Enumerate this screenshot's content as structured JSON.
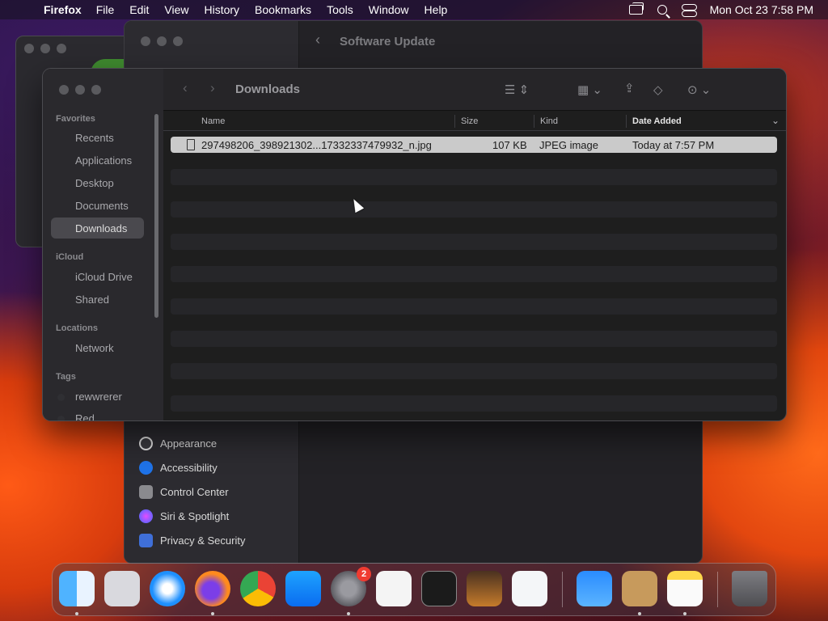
{
  "menubar": {
    "app_name": "Firefox",
    "items": [
      "File",
      "Edit",
      "View",
      "History",
      "Bookmarks",
      "Tools",
      "Window",
      "Help"
    ],
    "clock": "Mon Oct 23  7:58 PM"
  },
  "settings_window": {
    "title": "Software Update",
    "sidebar_items": [
      "Appearance",
      "Accessibility",
      "Control Center",
      "Siri & Spotlight",
      "Privacy & Security"
    ]
  },
  "finder": {
    "title": "Downloads",
    "sidebar": {
      "favorites_header": "Favorites",
      "favorites": [
        "Recents",
        "Applications",
        "Desktop",
        "Documents",
        "Downloads"
      ],
      "icloud_header": "iCloud",
      "icloud": [
        "iCloud Drive",
        "Shared"
      ],
      "locations_header": "Locations",
      "locations": [
        "Network"
      ],
      "tags_header": "Tags",
      "tags": [
        "rewwrerer",
        "Red"
      ]
    },
    "columns": {
      "name": "Name",
      "size": "Size",
      "kind": "Kind",
      "date": "Date Added"
    },
    "files": [
      {
        "name": "297498206_398921302...17332337479932_n.jpg",
        "size": "107 KB",
        "kind": "JPEG image",
        "date": "Today at 7:57 PM"
      }
    ]
  },
  "dock": {
    "apps": [
      "Finder",
      "Launchpad",
      "Safari",
      "Firefox",
      "Chrome",
      "App Store",
      "System Settings",
      "TextEdit",
      "Terminal",
      "GarageBand",
      "Visual Studio Code",
      "Weather",
      "Contacts",
      "Notes",
      "Trash"
    ],
    "settings_badge": "2"
  }
}
